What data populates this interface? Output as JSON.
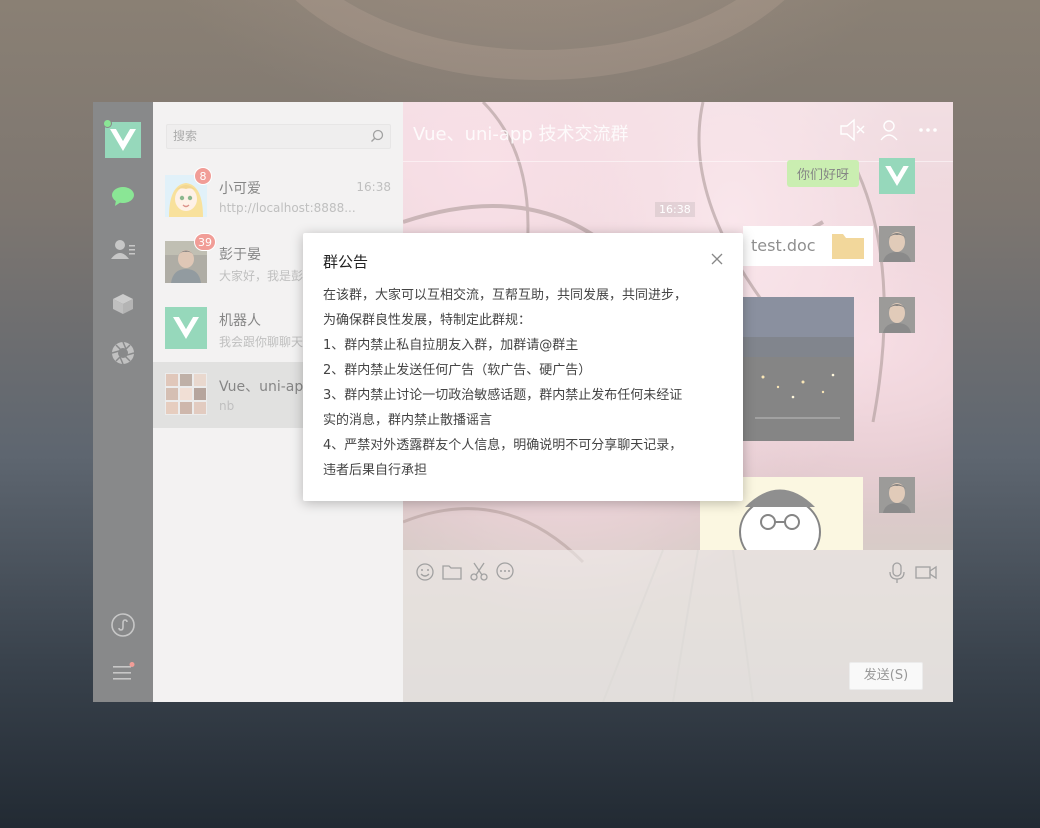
{
  "search": {
    "placeholder": "搜索"
  },
  "conversations": [
    {
      "name": "小可爱",
      "preview": "http://localhost:8888...",
      "time": "16:38",
      "badge": "8"
    },
    {
      "name": "彭于晏",
      "preview": "大家好，我是彭于晏",
      "time": "",
      "badge": "39"
    },
    {
      "name": "机器人",
      "preview": "我会跟你聊聊天哦",
      "time": "",
      "badge": ""
    },
    {
      "name": "Vue、uni-app",
      "preview": "nb",
      "time": "",
      "badge": ""
    }
  ],
  "chat": {
    "title": "Vue、uni-app 技术交流群",
    "messages": {
      "greeting": "你们好呀",
      "time": "16:38",
      "file_name": "test.doc"
    },
    "send_label": "发送(S)"
  },
  "modal": {
    "title": "群公告",
    "lines": [
      "在该群，大家可以互相交流，互帮互助，共同发展，共同进步，",
      "为确保群良性发展，特制定此群规：",
      "1、群内禁止私自拉朋友入群，加群请@群主",
      "2、群内禁止发送任何广告（软广告、硬广告）",
      "3、群内禁止讨论一切政治敏感话题，群内禁止发布任何未经证",
      "实的消息，群内禁止散播谣言",
      "4、严禁对外透露群友个人信息，明确说明不可分享聊天记录，",
      "违者后果自行承担"
    ]
  },
  "colors": {
    "accent": "#41b883",
    "rail": "#27292b",
    "badge": "#e54d42",
    "bubble": "#9fe072"
  }
}
